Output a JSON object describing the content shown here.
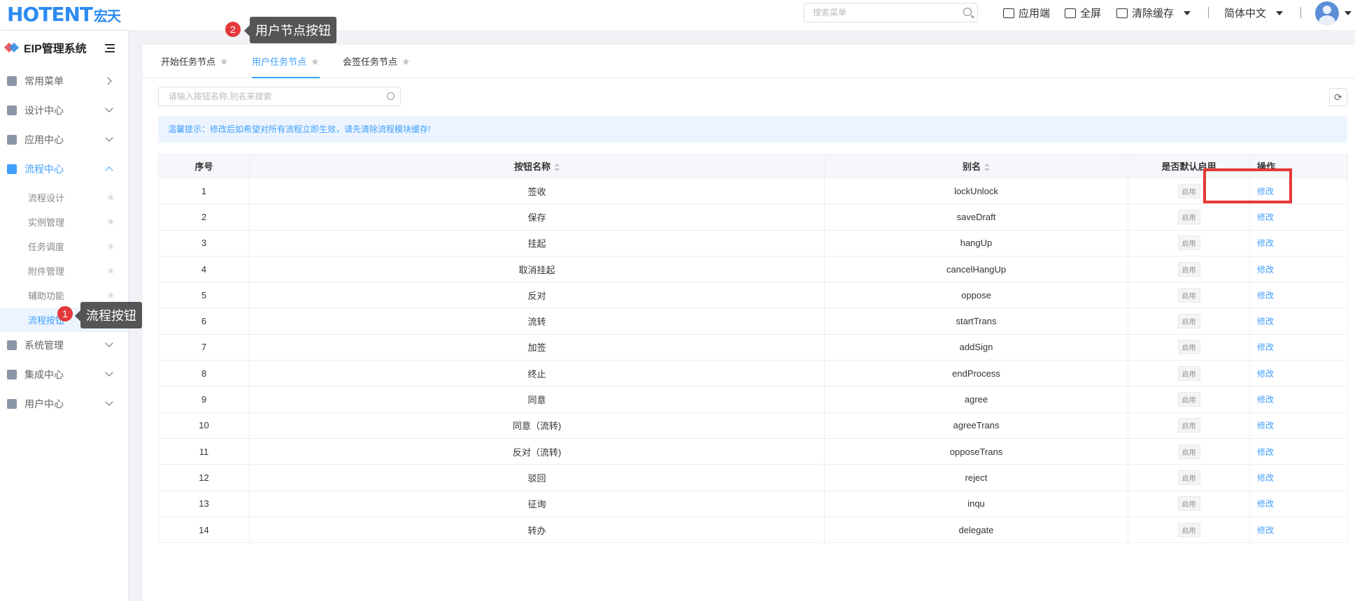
{
  "header": {
    "logo_en": "HOTENT",
    "logo_cn": "宏天",
    "search_placeholder": "搜索菜单",
    "actions": {
      "app": "应用端",
      "fullscreen": "全屏",
      "clear_cache": "清除缓存",
      "language": "简体中文"
    }
  },
  "sidebar": {
    "title": "EIP管理系统",
    "menus": [
      {
        "label": "常用菜单",
        "icon": "grid-icon"
      },
      {
        "label": "设计中心",
        "icon": "design-icon"
      },
      {
        "label": "应用中心",
        "icon": "apps-icon"
      },
      {
        "label": "流程中心",
        "icon": "flow-icon"
      },
      {
        "label": "系统管理",
        "icon": "gear-icon"
      },
      {
        "label": "集成中心",
        "icon": "layers-icon"
      },
      {
        "label": "用户中心",
        "icon": "user-icon"
      }
    ],
    "sub_items": [
      "流程设计",
      "实例管理",
      "任务调度",
      "附件管理",
      "辅助功能",
      "流程按钮"
    ]
  },
  "callouts": {
    "one": {
      "num": "1",
      "text": "流程按钮"
    },
    "two": {
      "num": "2",
      "text": "用户节点按钮"
    }
  },
  "tabs": [
    "开始任务节点",
    "用户任务节点",
    "会签任务节点"
  ],
  "toolbar": {
    "search_placeholder": "请输入按钮名称,别名来搜索",
    "refresh_icon": "refresh-icon"
  },
  "alert": "温馨提示：修改后如希望对所有流程立即生效，请先清除流程模块缓存!",
  "table": {
    "headers": [
      "序号",
      "按钮名称",
      "别名",
      "是否默认启用",
      "操作"
    ],
    "tag_label": "启用",
    "edit_label": "修改",
    "rows": [
      {
        "no": "1",
        "name": "签收",
        "alias": "lockUnlock"
      },
      {
        "no": "2",
        "name": "保存",
        "alias": "saveDraft"
      },
      {
        "no": "3",
        "name": "挂起",
        "alias": "hangUp"
      },
      {
        "no": "4",
        "name": "取消挂起",
        "alias": "cancelHangUp"
      },
      {
        "no": "5",
        "name": "反对",
        "alias": "oppose"
      },
      {
        "no": "6",
        "name": "流转",
        "alias": "startTrans"
      },
      {
        "no": "7",
        "name": "加签",
        "alias": "addSign"
      },
      {
        "no": "8",
        "name": "终止",
        "alias": "endProcess"
      },
      {
        "no": "9",
        "name": "同意",
        "alias": "agree"
      },
      {
        "no": "10",
        "name": "同意（流转)",
        "alias": "agreeTrans"
      },
      {
        "no": "11",
        "name": "反对（流转)",
        "alias": "opposeTrans"
      },
      {
        "no": "12",
        "name": "驳回",
        "alias": "reject"
      },
      {
        "no": "13",
        "name": "征询",
        "alias": "inqu"
      },
      {
        "no": "14",
        "name": "转办",
        "alias": "delegate"
      }
    ]
  },
  "colors": {
    "accent": "#409eff",
    "highlight": "#e53935",
    "badge": "#e4393c"
  }
}
